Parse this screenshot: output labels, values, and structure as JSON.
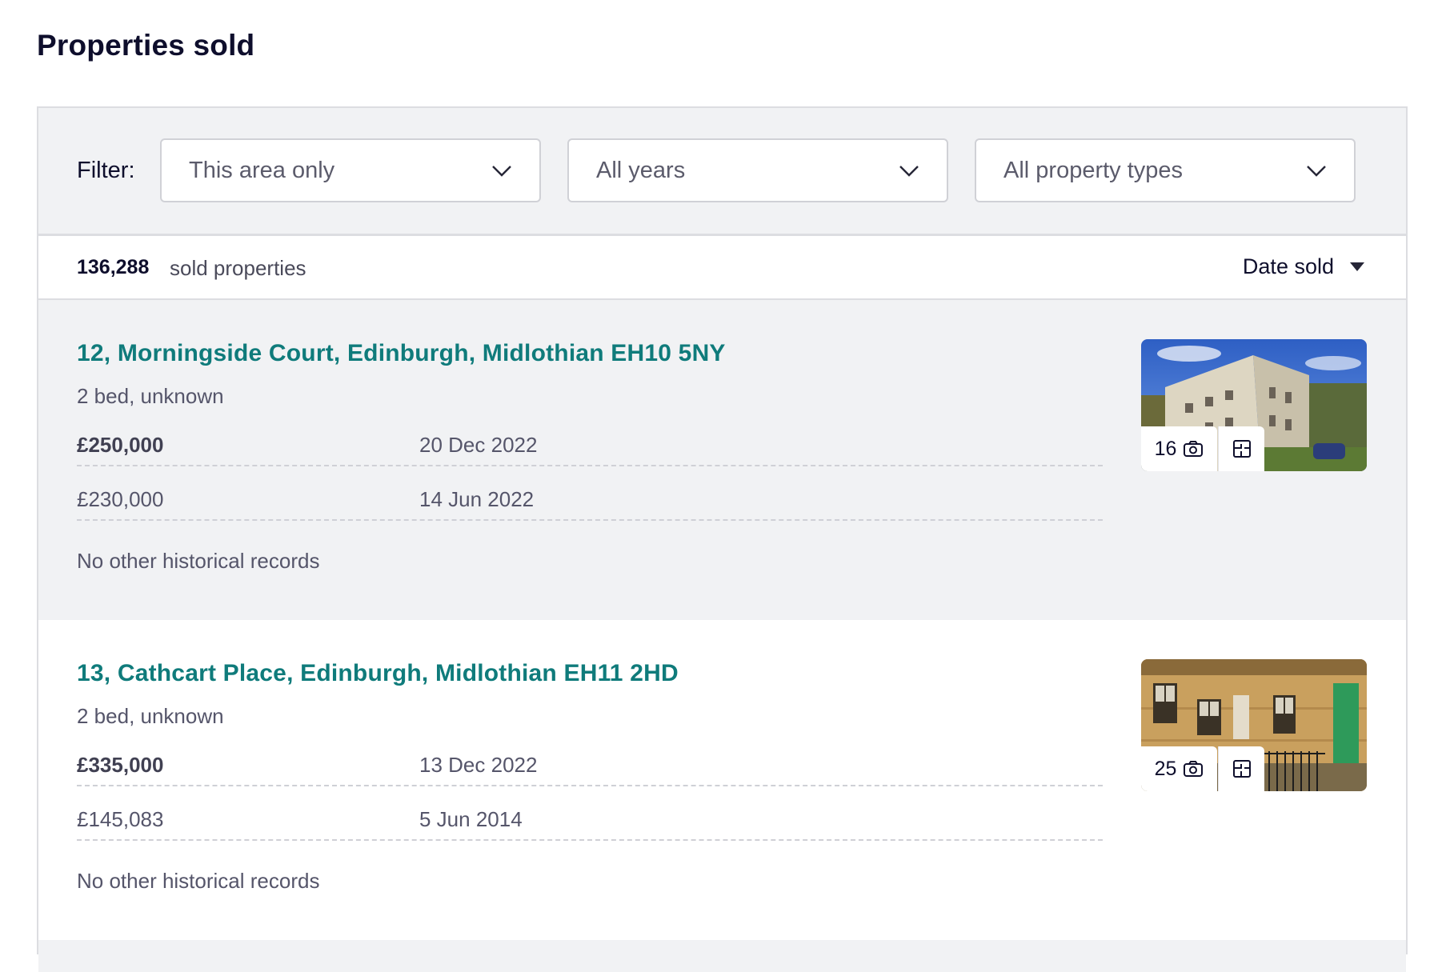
{
  "page": {
    "title": "Properties sold"
  },
  "filters": {
    "label": "Filter:",
    "area": "This area only",
    "years": "All years",
    "property_types": "All property types"
  },
  "summary": {
    "count": "136,288",
    "count_label": "sold properties",
    "sort_label": "Date sold"
  },
  "listings": [
    {
      "address": "12, Morningside Court, Edinburgh, Midlothian EH10 5NY",
      "subtitle": "2 bed, unknown",
      "sales": [
        {
          "price": "£250,000",
          "date": "20 Dec 2022"
        },
        {
          "price": "£230,000",
          "date": "14 Jun 2022"
        }
      ],
      "history_note": "No other historical records",
      "photo_count": "16"
    },
    {
      "address": "13, Cathcart Place, Edinburgh, Midlothian EH11 2HD",
      "subtitle": "2 bed, unknown",
      "sales": [
        {
          "price": "£335,000",
          "date": "13 Dec 2022"
        },
        {
          "price": "£145,083",
          "date": "5 Jun 2014"
        }
      ],
      "history_note": "No other historical records",
      "photo_count": "25"
    }
  ],
  "icons": {
    "dropdown": "chevron-down-icon",
    "sort": "caret-down-icon",
    "photos": "camera-icon",
    "floorplan": "floorplan-icon"
  },
  "colors": {
    "accent_link": "#0f7b7b",
    "title": "#0e0e2c",
    "filter_bg": "#f1f2f4"
  }
}
